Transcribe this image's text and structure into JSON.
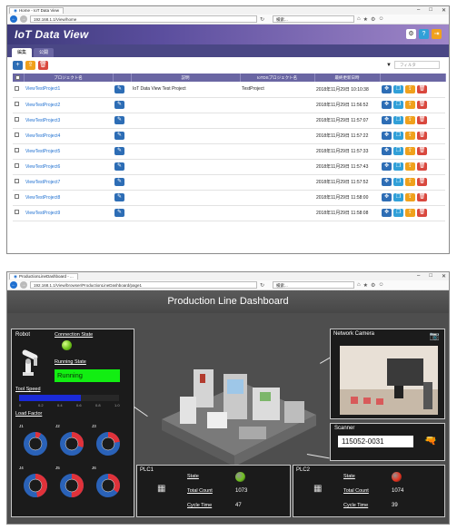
{
  "win1": {
    "tab_title": "Home - IoT Data View",
    "url": "192.168.1.1/View/home",
    "search_placeholder": "検索...",
    "app_title": "IoT Data View",
    "tabs": [
      "編集",
      "公開"
    ],
    "filter_placeholder": "フィルタ",
    "columns": [
      "プロジェクト名",
      "説明",
      "IoTDSプロジェクト名",
      "最終更新日時"
    ],
    "rows": [
      {
        "name": "ViewTestProject1",
        "desc": "IoT Data View Test Project",
        "ds": "TestProject",
        "updated": "2018年11月29日 10:10:38"
      },
      {
        "name": "ViewTestProject2",
        "desc": "",
        "ds": "",
        "updated": "2018年11月29日 11:56:52"
      },
      {
        "name": "ViewTestProject3",
        "desc": "",
        "ds": "",
        "updated": "2018年11月29日 11:57:07"
      },
      {
        "name": "ViewTestProject4",
        "desc": "",
        "ds": "",
        "updated": "2018年11月29日 11:57:22"
      },
      {
        "name": "ViewTestProject5",
        "desc": "",
        "ds": "",
        "updated": "2018年11月29日 11:57:33"
      },
      {
        "name": "ViewTestProject6",
        "desc": "",
        "ds": "",
        "updated": "2018年11月29日 11:57:43"
      },
      {
        "name": "ViewTestProject7",
        "desc": "",
        "ds": "",
        "updated": "2018年11月29日 11:57:52"
      },
      {
        "name": "ViewTestProject8",
        "desc": "",
        "ds": "",
        "updated": "2018年11月29日 11:58:00"
      },
      {
        "name": "ViewTestProject9",
        "desc": "",
        "ds": "",
        "updated": "2018年11月29日 11:58:08"
      }
    ]
  },
  "win2": {
    "tab_title": "ProductionLineDashboard - ...",
    "url": "192.168.1.1/View/browser/ProductionLineDashboard/page1",
    "search_placeholder": "検索...",
    "title": "Production Line Dashboard",
    "robot": {
      "title": "Robot",
      "connection_label": "Connection State",
      "running_label": "Running State",
      "running_value": "Running",
      "tool_speed_label": "Tool Speed",
      "tool_speed_level": 0.62,
      "scale": [
        "0",
        "0.2",
        "0.4",
        "0.6",
        "0.8",
        "1.0"
      ],
      "load_factor_label": "Load Factor",
      "joints": [
        {
          "label": "J1",
          "load": 0.08
        },
        {
          "label": "J2",
          "load": 0.3
        },
        {
          "label": "J3",
          "load": 0.22
        },
        {
          "label": "J4",
          "load": 0.47
        },
        {
          "label": "J5",
          "load": 0.5
        },
        {
          "label": "J6",
          "load": 0.35
        }
      ]
    },
    "camera": {
      "title": "Network Camera"
    },
    "scanner": {
      "title": "Scanner",
      "value": "115052-0031"
    },
    "plc1": {
      "title": "PLC1",
      "state_label": "State",
      "state_color": "#6fc21c",
      "total_label": "Total Count",
      "total_value": "1073",
      "cycle_label": "Cycle Time",
      "cycle_value": "47"
    },
    "plc2": {
      "title": "PLC2",
      "state_label": "State",
      "state_color": "#e8321e",
      "total_label": "Total Count",
      "total_value": "1074",
      "cycle_label": "Cycle Time",
      "cycle_value": "39"
    }
  }
}
